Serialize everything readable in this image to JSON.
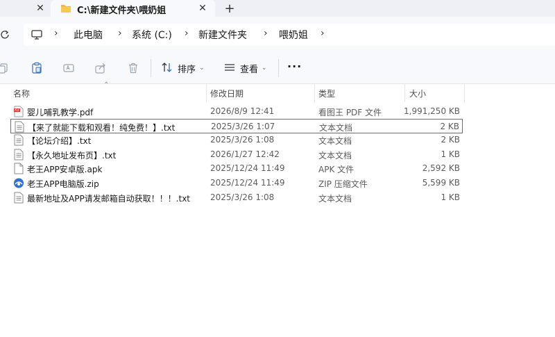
{
  "window": {
    "tab_title": "C:\\新建文件夹\\喂奶姐",
    "tab_close_glyph": "✕",
    "tab_add_glyph": "+"
  },
  "address": {
    "crumbs": [
      "此电脑",
      "系统 (C:)",
      "新建文件夹",
      "喂奶姐"
    ]
  },
  "toolbar": {
    "sort_label": "排序",
    "view_label": "查看",
    "more_label": "···"
  },
  "columns": {
    "name": "名称",
    "date": "修改日期",
    "type": "类型",
    "size": "大小"
  },
  "files": [
    {
      "icon": "pdf-file-icon",
      "name": "婴儿哺乳教学.pdf",
      "date": "2026/8/9 12:41",
      "type": "看图王 PDF 文件",
      "size": "1,991,250 KB",
      "selected": false
    },
    {
      "icon": "text-file-icon",
      "name": "【来了就能下载和观看！纯免费！】.txt",
      "date": "2025/3/26 1:07",
      "type": "文本文档",
      "size": "2 KB",
      "selected": true
    },
    {
      "icon": "text-file-icon",
      "name": "【论坛介绍】.txt",
      "date": "2025/3/26 1:08",
      "type": "文本文档",
      "size": "2 KB",
      "selected": false
    },
    {
      "icon": "text-file-icon",
      "name": "【永久地址发布页】.txt",
      "date": "2026/1/27 12:42",
      "type": "文本文档",
      "size": "1 KB",
      "selected": false
    },
    {
      "icon": "blank-file-icon",
      "name": "老王APP安卓版.apk",
      "date": "2025/12/24 11:49",
      "type": "APK 文件",
      "size": "2,592 KB",
      "selected": false
    },
    {
      "icon": "zip-file-icon",
      "name": "老王APP电脑版.zip",
      "date": "2025/12/24 11:49",
      "type": "ZIP 压缩文件",
      "size": "5,599 KB",
      "selected": false
    },
    {
      "icon": "text-file-icon",
      "name": "最新地址及APP请发邮箱自动获取！！！.txt",
      "date": "2025/3/26 1:08",
      "type": "文本文档",
      "size": "1 KB",
      "selected": false
    }
  ],
  "colors": {
    "accent": "#2f6fd6",
    "folder": "#f2b93b",
    "pdf": "#d7322c"
  }
}
